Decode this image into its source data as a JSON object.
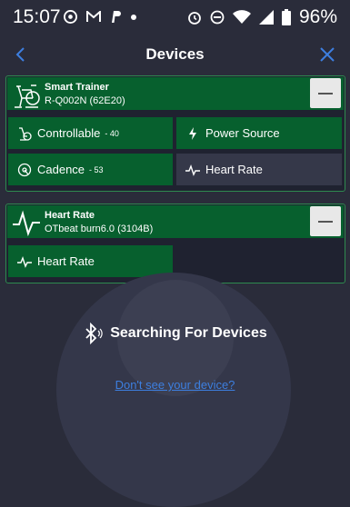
{
  "status": {
    "time": "15:07",
    "battery": "96%"
  },
  "header": {
    "title": "Devices"
  },
  "devices": [
    {
      "name": "Smart Trainer",
      "id": "R-Q002N (62E20)",
      "capabilities": [
        {
          "label": "Controllable",
          "value": "40",
          "active": true
        },
        {
          "label": "Power Source",
          "value": "",
          "active": true
        },
        {
          "label": "Cadence",
          "value": "53",
          "active": true
        },
        {
          "label": "Heart Rate",
          "value": "",
          "active": false
        }
      ]
    },
    {
      "name": "Heart Rate",
      "id": "OTbeat burn6.0 (3104B)",
      "capabilities": [
        {
          "label": "Heart Rate",
          "value": "",
          "active": true
        }
      ]
    }
  ],
  "search": {
    "label": "Searching For Devices",
    "help_link": "Don't see your device?"
  },
  "colors": {
    "background": "#2a2c3a",
    "device_green": "#07602e",
    "link_blue": "#3d7fe0"
  }
}
